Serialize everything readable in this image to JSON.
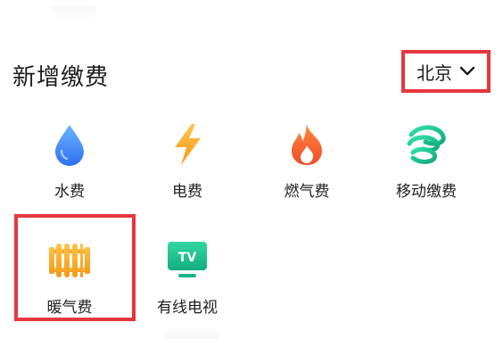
{
  "section": {
    "title": "新增缴费"
  },
  "city_selector": {
    "value": "北京",
    "icon": "chevron-down-icon"
  },
  "payment_items": [
    {
      "label": "水费",
      "icon": "water-drop-icon",
      "color": "#3b82f6"
    },
    {
      "label": "电费",
      "icon": "lightning-bolt-icon",
      "color": "#f5a623"
    },
    {
      "label": "燃气费",
      "icon": "flame-icon",
      "color": "#f25c2b"
    },
    {
      "label": "移动缴费",
      "icon": "china-mobile-logo-icon",
      "color": "#19c08a"
    },
    {
      "label": "暖气费",
      "icon": "radiator-icon",
      "color": "#f5a623"
    },
    {
      "label": "有线电视",
      "icon": "tv-icon",
      "color": "#1fbf8e",
      "icon_text": "TV"
    }
  ],
  "colors": {
    "highlight_border": "#e6373f"
  }
}
